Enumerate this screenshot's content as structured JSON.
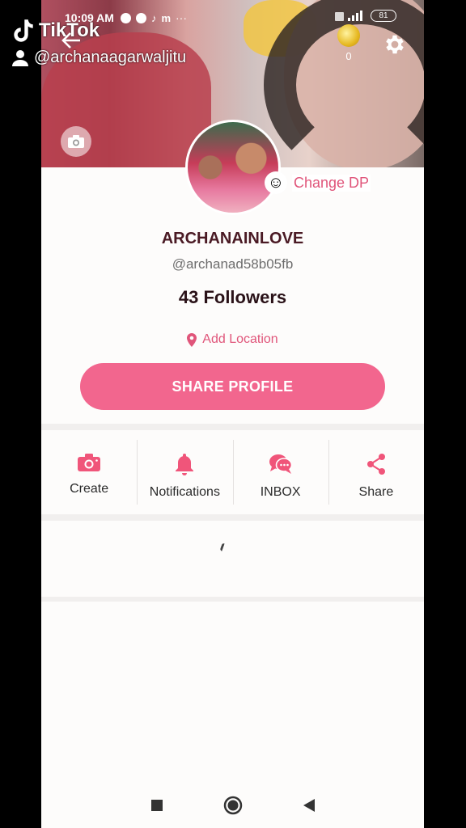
{
  "status_bar": {
    "time": "10:09 AM",
    "battery": "81"
  },
  "watermark": {
    "brand": "TikTok",
    "user": "@archanaagarwaljitu"
  },
  "header": {
    "coin_count": "0"
  },
  "profile": {
    "change_dp": "Change DP",
    "name": "ARCHANAINLOVE",
    "handle": "@archanad58b05fb",
    "followers": "43 Followers",
    "location": "Add Location",
    "share_button": "SHARE PROFILE"
  },
  "actions": [
    {
      "label": "Create",
      "icon": "camera-icon"
    },
    {
      "label": "Notifications",
      "icon": "bell-icon"
    },
    {
      "label": "INBOX",
      "icon": "chat-icon"
    },
    {
      "label": "Share",
      "icon": "share-icon"
    }
  ],
  "colors": {
    "accent": "#f2668e",
    "accent_text": "#e0557a",
    "name": "#4a1a24"
  }
}
